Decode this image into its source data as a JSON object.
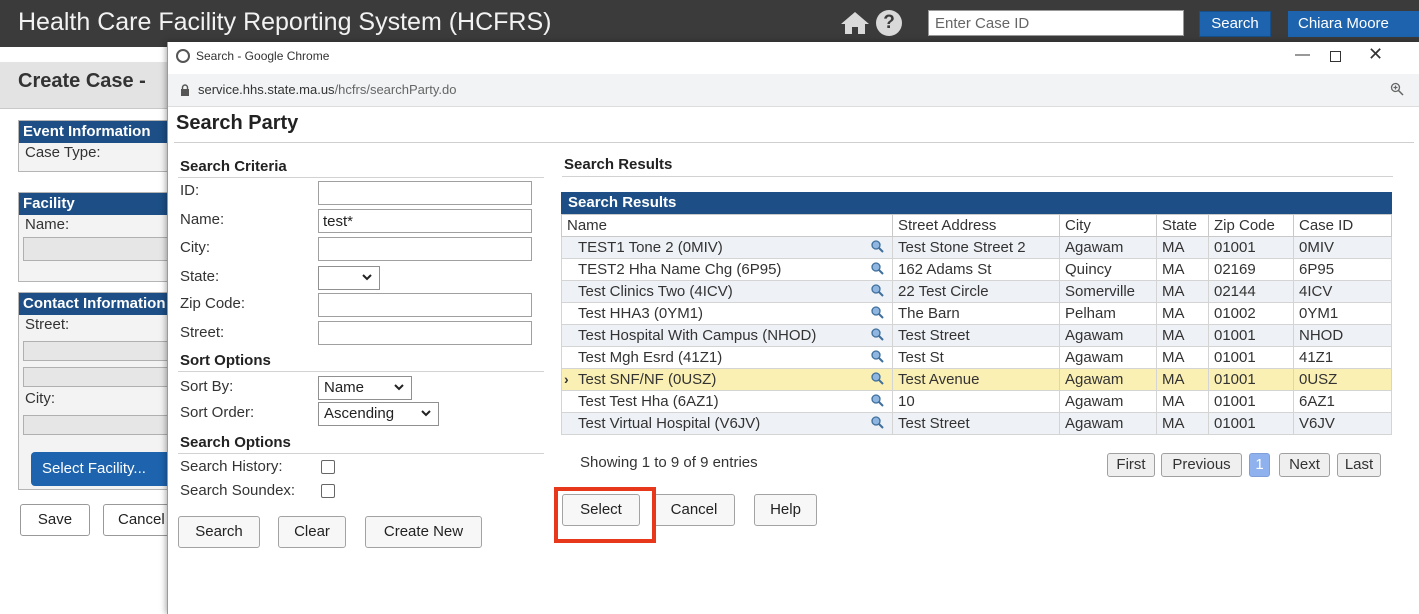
{
  "app": {
    "title": "Health Care Facility Reporting System (HCFRS)",
    "case_id_placeholder": "Enter Case ID",
    "search_label": "Search",
    "user_label": "Chiara Moore"
  },
  "page": {
    "title": "Create Case -",
    "event_panel": {
      "heading": "Event Information",
      "case_type_label": "Case Type:"
    },
    "facility_panel": {
      "heading": "Facility",
      "name_label": "Name:"
    },
    "contact_panel": {
      "heading": "Contact Information",
      "street_label": "Street:",
      "city_label": "City:"
    },
    "select_facility_label": "Select Facility...",
    "save_label": "Save",
    "cancel_label": "Cancel"
  },
  "popup": {
    "window_title": "Search - Google Chrome",
    "url_domain": "service.hhs.state.ma.us",
    "url_path": "/hcfrs/searchParty.do",
    "heading": "Search Party",
    "criteria": {
      "heading": "Search Criteria",
      "id_label": "ID:",
      "id_value": "",
      "name_label": "Name:",
      "name_value": "test*",
      "city_label": "City:",
      "city_value": "",
      "state_label": "State:",
      "state_value": "",
      "zip_label": "Zip Code:",
      "zip_value": "",
      "street_label": "Street:",
      "street_value": ""
    },
    "sort": {
      "heading": "Sort Options",
      "sort_by_label": "Sort By:",
      "sort_by_value": "Name",
      "sort_order_label": "Sort Order:",
      "sort_order_value": "Ascending"
    },
    "options": {
      "heading": "Search Options",
      "history_label": "Search History:",
      "soundex_label": "Search Soundex:"
    },
    "buttons": {
      "search": "Search",
      "clear": "Clear",
      "create_new": "Create New"
    },
    "results": {
      "section_title": "Search Results",
      "table_caption": "Search Results",
      "columns": [
        "Name",
        "Street Address",
        "City",
        "State",
        "Zip Code",
        "Case ID"
      ],
      "rows": [
        [
          "TEST1 Tone 2 (0MIV)",
          "Test Stone Street 2",
          "Agawam",
          "MA",
          "01001",
          "0MIV"
        ],
        [
          "TEST2 Hha Name Chg (6P95)",
          "162 Adams St",
          "Quincy",
          "MA",
          "02169",
          "6P95"
        ],
        [
          "Test Clinics Two (4ICV)",
          "22 Test Circle",
          "Somerville",
          "MA",
          "02144",
          "4ICV"
        ],
        [
          "Test HHA3 (0YM1)",
          "The Barn",
          "Pelham",
          "MA",
          "01002",
          "0YM1"
        ],
        [
          "Test Hospital With Campus (NHOD)",
          "Test Street",
          "Agawam",
          "MA",
          "01001",
          "NHOD"
        ],
        [
          "Test Mgh Esrd (41Z1)",
          "Test St",
          "Agawam",
          "MA",
          "01001",
          "41Z1"
        ],
        [
          "Test SNF/NF (0USZ)",
          "Test Avenue",
          "Agawam",
          "MA",
          "01001",
          "0USZ"
        ],
        [
          "Test Test Hha (6AZ1)",
          "10",
          "Agawam",
          "MA",
          "01001",
          "6AZ1"
        ],
        [
          "Test Virtual Hospital (V6JV)",
          "Test Street",
          "Agawam",
          "MA",
          "01001",
          "V6JV"
        ]
      ],
      "selected_index": 6,
      "showing": "Showing 1 to 9 of 9 entries",
      "pagination": {
        "first": "First",
        "previous": "Previous",
        "current": "1",
        "next": "Next",
        "last": "Last"
      }
    },
    "actions": {
      "select": "Select",
      "cancel": "Cancel",
      "help": "Help"
    }
  },
  "colors": {
    "topbar": "#3b3b3b",
    "panel_header": "#1d4f86",
    "primary_button": "#1d63ad",
    "selected_row": "#fbf0b4",
    "highlight_box": "#e8381b",
    "active_page": "#8fb2ee"
  }
}
